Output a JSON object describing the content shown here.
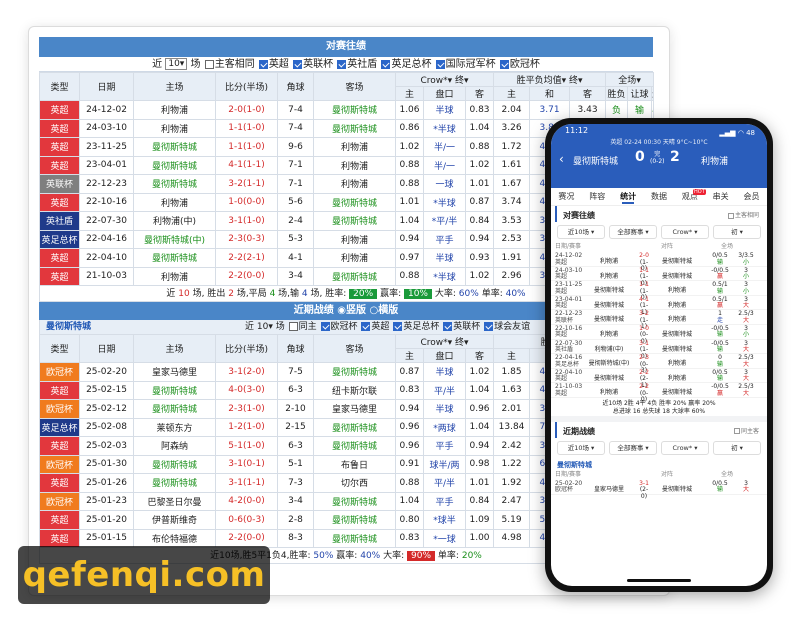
{
  "h2h": {
    "title": "对赛往绩",
    "filter": {
      "prefix": "近",
      "count": "10",
      "suffix": "场",
      "opt_same": "主客相同",
      "leagues": [
        "英超",
        "英联杯",
        "英社盾",
        "英足总杯",
        "国际冠军杯",
        "欧冠杯"
      ]
    },
    "headers": {
      "type": "类型",
      "date": "日期",
      "home": "主场",
      "score": "比分(半场)",
      "corner": "角球",
      "away": "客场",
      "company": "Crow*",
      "term": "终",
      "wdl_label": "胜平负均值",
      "term2": "终",
      "all": "全场",
      "sub_main": "主",
      "sub_line": "盘口",
      "sub_away": "客",
      "sub_win": "主",
      "sub_draw": "和",
      "sub_lose": "客",
      "result": "胜负",
      "handicap": "让球",
      "goals": "进球数"
    },
    "rows": [
      {
        "type": "英超",
        "tc": "t-red",
        "date": "24-12-02",
        "home": "利物浦",
        "hc": "",
        "score": "2-0(1-0)",
        "sc": "red",
        "corner": "7-4",
        "away": "曼彻斯特城",
        "ac": "green",
        "o1": "1.06",
        "line": "半球",
        "o2": "0.83",
        "w": "2.04",
        "d": "3.71",
        "l": "3.43",
        "res": "负",
        "rc": "green",
        "hcap": "输",
        "hcc": "green",
        "gl": "小",
        "gc": "green"
      },
      {
        "type": "英超",
        "tc": "t-red",
        "date": "24-03-10",
        "home": "利物浦",
        "hc": "",
        "score": "1-1(1-0)",
        "sc": "red",
        "corner": "7-4",
        "away": "曼彻斯特城",
        "ac": "green",
        "o1": "0.86",
        "line": "*半球",
        "o2": "1.04",
        "w": "3.26",
        "d": "3.80",
        "l": "2.08",
        "res": "",
        "rc": "",
        "hcap": "",
        "hcc": "",
        "gl": "",
        "gc": ""
      },
      {
        "type": "英超",
        "tc": "t-red",
        "date": "23-11-25",
        "home": "曼彻斯特城",
        "hc": "green",
        "score": "1-1(1-0)",
        "sc": "red",
        "corner": "9-6",
        "away": "利物浦",
        "ac": "",
        "o1": "1.02",
        "line": "半/一",
        "o2": "0.88",
        "w": "1.72",
        "d": "4.21",
        "l": "4.24",
        "res": "",
        "rc": "",
        "hcap": "",
        "hcc": "",
        "gl": "",
        "gc": ""
      },
      {
        "type": "英超",
        "tc": "t-red",
        "date": "23-04-01",
        "home": "曼彻斯特城",
        "hc": "green",
        "score": "4-1(1-1)",
        "sc": "red",
        "corner": "7-1",
        "away": "利物浦",
        "ac": "",
        "o1": "0.88",
        "line": "半/一",
        "o2": "1.02",
        "w": "1.61",
        "d": "4.23",
        "l": "5.33",
        "res": "",
        "rc": "",
        "hcap": "",
        "hcc": "",
        "gl": "",
        "gc": ""
      },
      {
        "type": "英联杯",
        "tc": "t-gray",
        "date": "22-12-23",
        "home": "曼彻斯特城",
        "hc": "green",
        "score": "3-2(1-1)",
        "sc": "red",
        "corner": "7-1",
        "away": "利物浦",
        "ac": "",
        "o1": "0.88",
        "line": "一球",
        "o2": "1.01",
        "w": "1.67",
        "d": "4.19",
        "l": "4.60",
        "res": "",
        "rc": "",
        "hcap": "",
        "hcc": "",
        "gl": "",
        "gc": ""
      },
      {
        "type": "英超",
        "tc": "t-red",
        "date": "22-10-16",
        "home": "利物浦",
        "hc": "",
        "score": "1-0(0-0)",
        "sc": "red",
        "corner": "5-6",
        "away": "曼彻斯特城",
        "ac": "green",
        "o1": "1.01",
        "line": "*半球",
        "o2": "0.87",
        "w": "3.74",
        "d": "4.10",
        "l": "1.88",
        "res": "",
        "rc": "",
        "hcap": "",
        "hcc": "",
        "gl": "",
        "gc": ""
      },
      {
        "type": "英社盾",
        "tc": "t-navy",
        "date": "22-07-30",
        "home": "利物浦(中)",
        "hc": "",
        "score": "3-1(1-0)",
        "sc": "red",
        "corner": "2-4",
        "away": "曼彻斯特城",
        "ac": "green",
        "o1": "1.04",
        "line": "*平/半",
        "o2": "0.84",
        "w": "3.53",
        "d": "3.53",
        "l": "2.23",
        "res": "",
        "rc": "",
        "hcap": "",
        "hcc": "",
        "gl": "",
        "gc": ""
      },
      {
        "type": "英足总杯",
        "tc": "t-navy",
        "date": "22-04-16",
        "home": "曼彻斯特城(中)",
        "hc": "green",
        "score": "2-3(0-3)",
        "sc": "red",
        "corner": "5-3",
        "away": "利物浦",
        "ac": "",
        "o1": "0.94",
        "line": "平手",
        "o2": "0.94",
        "w": "2.53",
        "d": "3.86",
        "l": "2.78",
        "res": "",
        "rc": "",
        "hcap": "",
        "hcc": "",
        "gl": "",
        "gc": ""
      },
      {
        "type": "英超",
        "tc": "t-red",
        "date": "22-04-10",
        "home": "曼彻斯特城",
        "hc": "green",
        "score": "2-2(2-1)",
        "sc": "red",
        "corner": "4-1",
        "away": "利物浦",
        "ac": "",
        "o1": "0.97",
        "line": "半球",
        "o2": "0.93",
        "w": "1.91",
        "d": "4.28",
        "l": "3.92",
        "res": "",
        "rc": "",
        "hcap": "",
        "hcc": "",
        "gl": "",
        "gc": ""
      },
      {
        "type": "英超",
        "tc": "t-red",
        "date": "21-10-03",
        "home": "利物浦",
        "hc": "",
        "score": "2-2(0-0)",
        "sc": "red",
        "corner": "3-4",
        "away": "曼彻斯特城",
        "ac": "green",
        "o1": "0.88",
        "line": "*半球",
        "o2": "1.02",
        "w": "2.96",
        "d": "3.54",
        "l": "2.33",
        "res": "",
        "rc": "",
        "hcap": "",
        "hcc": "",
        "gl": "",
        "gc": ""
      }
    ],
    "summary": {
      "p1": "近",
      "n": "10",
      "p2": "场, 胜出",
      "w": "2",
      "p3": "场,平局",
      "d": "4",
      "p4": "场,输",
      "l": "4",
      "p5": "场, 胜率:",
      "winrate": "20%",
      "p6": "赢率:",
      "winrate2": "10%",
      "p7": "大率:",
      "big": "60%",
      "p8": "单率:",
      "odd": "40%"
    }
  },
  "recent": {
    "title": "近期战绩",
    "opt1": "竖版",
    "opt2": "横版",
    "team": "曼彻斯特城",
    "ctrl": {
      "prefix": "近",
      "count": "10",
      "suffix": "场",
      "same": "同主",
      "leagues": [
        "欧冠杯",
        "英超",
        "英足总杯",
        "英联杯",
        "球会友谊"
      ]
    },
    "rows": [
      {
        "type": "欧冠杯",
        "tc": "t-orange",
        "date": "25-02-20",
        "home": "皇家马德里",
        "hc": "",
        "score": "3-1(2-0)",
        "corner": "7-5",
        "away": "曼彻斯特城",
        "ac": "green",
        "o1": "0.87",
        "line": "半球",
        "o2": "1.02",
        "w": "1.85",
        "d": "4.23",
        "l": "3.69"
      },
      {
        "type": "英超",
        "tc": "t-red",
        "date": "25-02-15",
        "home": "曼彻斯特城",
        "hc": "green",
        "score": "4-0(3-0)",
        "corner": "6-3",
        "away": "纽卡斯尔联",
        "ac": "",
        "o1": "0.83",
        "line": "平/半",
        "o2": "1.04",
        "w": "1.63",
        "d": "4.43",
        "l": "4.50"
      },
      {
        "type": "欧冠杯",
        "tc": "t-orange",
        "date": "25-02-12",
        "home": "曼彻斯特城",
        "hc": "green",
        "score": "2-3(1-0)",
        "corner": "2-10",
        "away": "皇家马德里",
        "ac": "",
        "o1": "0.94",
        "line": "半球",
        "o2": "0.96",
        "w": "2.01",
        "d": "3.92",
        "l": "3.39"
      },
      {
        "type": "英足总杯",
        "tc": "t-navy",
        "date": "25-02-08",
        "home": "莱顿东方",
        "hc": "",
        "score": "1-2(1-0)",
        "corner": "2-15",
        "away": "曼彻斯特城",
        "ac": "green",
        "o1": "0.96",
        "line": "*两球",
        "o2": "1.04",
        "w": "13.84",
        "d": "7.73",
        "l": "1.15"
      },
      {
        "type": "英超",
        "tc": "t-red",
        "date": "25-02-03",
        "home": "阿森纳",
        "hc": "",
        "score": "5-1(1-0)",
        "corner": "6-3",
        "away": "曼彻斯特城",
        "ac": "green",
        "o1": "0.96",
        "line": "平手",
        "o2": "0.94",
        "w": "2.42",
        "d": "3.52",
        "l": "2.82"
      },
      {
        "type": "欧冠杯",
        "tc": "t-orange",
        "date": "25-01-30",
        "home": "曼彻斯特城",
        "hc": "green",
        "score": "3-1(0-1)",
        "corner": "5-1",
        "away": "布鲁日",
        "ac": "",
        "o1": "0.91",
        "line": "球半/两",
        "o2": "0.98",
        "w": "1.22",
        "d": "6.89",
        "l": "11.64"
      },
      {
        "type": "英超",
        "tc": "t-red",
        "date": "25-01-26",
        "home": "曼彻斯特城",
        "hc": "green",
        "score": "3-1(1-1)",
        "corner": "7-3",
        "away": "切尔西",
        "ac": "",
        "o1": "0.88",
        "line": "平/半",
        "o2": "1.01",
        "w": "1.92",
        "d": "4.13",
        "l": "3.50"
      },
      {
        "type": "欧冠杯",
        "tc": "t-orange",
        "date": "25-01-23",
        "home": "巴黎圣日尔曼",
        "hc": "",
        "score": "4-2(0-0)",
        "corner": "3-4",
        "away": "曼彻斯特城",
        "ac": "green",
        "o1": "1.04",
        "line": "平手",
        "o2": "0.84",
        "w": "2.47",
        "d": "3.64",
        "l": "2.80"
      },
      {
        "type": "英超",
        "tc": "t-red",
        "date": "25-01-20",
        "home": "伊普斯维奇",
        "hc": "",
        "score": "0-6(0-3)",
        "corner": "2-8",
        "away": "曼彻斯特城",
        "ac": "green",
        "o1": "0.80",
        "line": "*球半",
        "o2": "1.09",
        "w": "5.19",
        "d": "5.11",
        "l": "1.68"
      },
      {
        "type": "英超",
        "tc": "t-red",
        "date": "25-01-15",
        "home": "布伦特福德",
        "hc": "",
        "score": "2-2(0-0)",
        "corner": "8-3",
        "away": "曼彻斯特城",
        "ac": "green",
        "o1": "0.83",
        "line": "*一球",
        "o2": "1.00",
        "w": "4.98",
        "d": "4.46",
        "l": "1.61"
      }
    ],
    "summary": {
      "p1": "近10场,胜5平1负4,胜率:",
      "winrate": "50%",
      "p2": "赢率:",
      "winrate2": "40%",
      "p3": "大率:",
      "big": "90%",
      "p4": "单率:",
      "odd": "20%"
    }
  },
  "watermark": "qefenqi.com",
  "phone": {
    "time": "11:12",
    "battery": "48",
    "match_info": "英超 02-24 00:30 天晴 9°C~10°C",
    "home_team": "曼彻斯特城",
    "home_score": "0",
    "half_top": "完",
    "half_bottom": "(0-2)",
    "away_score": "2",
    "away_team": "利物浦",
    "tabs": [
      "赛况",
      "阵容",
      "统计",
      "数据",
      "观点",
      "串关",
      "会员"
    ],
    "hot_badge": "HOT",
    "sec1": "对赛往绩",
    "sec1_opt": "主客相同",
    "filters1": [
      "近10场",
      "全部赛事",
      "Crow*",
      "初"
    ],
    "list_hdr": {
      "date": "日期/赛事",
      "vs": "对阵",
      "all": "全场"
    },
    "rows": [
      {
        "d": "24-12-02",
        "lg": "英超",
        "h": "利物浦",
        "s1": "2-0",
        "s2": "(1-0)",
        "a": "曼彻斯特城",
        "o1a": "0/0.5",
        "o1b": "输",
        "o2a": "3/3.5",
        "o2b": "小"
      },
      {
        "d": "24-03-10",
        "lg": "英超",
        "h": "利物浦",
        "s1": "1-1",
        "s2": "(1-0)",
        "a": "曼彻斯特城",
        "o1a": "-0/0.5",
        "o1b": "赢",
        "o2a": "3",
        "o2b": "小"
      },
      {
        "d": "23-11-25",
        "lg": "英超",
        "h": "曼彻斯特城",
        "s1": "1-1",
        "s2": "(1-0)",
        "a": "利物浦",
        "o1a": "0.5/1",
        "o1b": "输",
        "o2a": "3",
        "o2b": "小"
      },
      {
        "d": "23-04-01",
        "lg": "英超",
        "h": "曼彻斯特城",
        "s1": "4-1",
        "s2": "(1-1)",
        "a": "利物浦",
        "o1a": "0.5/1",
        "o1b": "赢",
        "o2a": "3",
        "o2b": "大"
      },
      {
        "d": "22-12-23",
        "lg": "英联杯",
        "h": "曼彻斯特城",
        "s1": "3-2",
        "s2": "(1-1)",
        "a": "利物浦",
        "o1a": "1",
        "o1b": "走",
        "o2a": "2.5/3",
        "o2b": "大"
      },
      {
        "d": "22-10-16",
        "lg": "英超",
        "h": "利物浦",
        "s1": "1-0",
        "s2": "(0-0)",
        "a": "曼彻斯特城",
        "o1a": "-0/0.5",
        "o1b": "输",
        "o2a": "3",
        "o2b": "小"
      },
      {
        "d": "22-07-30",
        "lg": "英社盾",
        "h": "利物浦(中)",
        "s1": "3-1",
        "s2": "(1-0)",
        "a": "曼彻斯特城",
        "o1a": "-0/0.5",
        "o1b": "输",
        "o2a": "3",
        "o2b": "大"
      },
      {
        "d": "22-04-16",
        "lg": "英足总杯",
        "h": "曼彻斯特城(中)",
        "s1": "2-3",
        "s2": "(0-3)",
        "a": "利物浦",
        "o1a": "0",
        "o1b": "输",
        "o2a": "2.5/3",
        "o2b": "大"
      },
      {
        "d": "22-04-10",
        "lg": "英超",
        "h": "曼彻斯特城",
        "s1": "2-2",
        "s2": "(2-1)",
        "a": "利物浦",
        "o1a": "0/0.5",
        "o1b": "输",
        "o2a": "3",
        "o2b": "大"
      },
      {
        "d": "21-10-03",
        "lg": "英超",
        "h": "利物浦",
        "s1": "2-2",
        "s2": "(0-0)",
        "a": "曼彻斯特城",
        "o1a": "-0/0.5",
        "o1b": "赢",
        "o2a": "2.5/3",
        "o2b": "大"
      }
    ],
    "sum1": "近10场 2胜 4平 4负 胜率 20% 赢率 20%",
    "sum2": "总进球 16 总失球 18 大球率 60%",
    "sec2": "近期战绩",
    "sec2_opt": "同主客",
    "filters2": [
      "近10场",
      "全部赛事",
      "Crow*",
      "初"
    ],
    "team": "曼彻斯特城",
    "list_hdr2": {
      "date": "日期/赛事",
      "vs": "对阵",
      "all": "全场"
    },
    "last_row": {
      "d": "25-02-20",
      "lg": "欧冠杯",
      "h": "皇家马德里",
      "s1": "3-1",
      "s2": "(2-0)",
      "a": "曼彻斯特城",
      "o1a": "0/0.5",
      "o1b": "输",
      "o2a": "3",
      "o2b": "大"
    }
  }
}
